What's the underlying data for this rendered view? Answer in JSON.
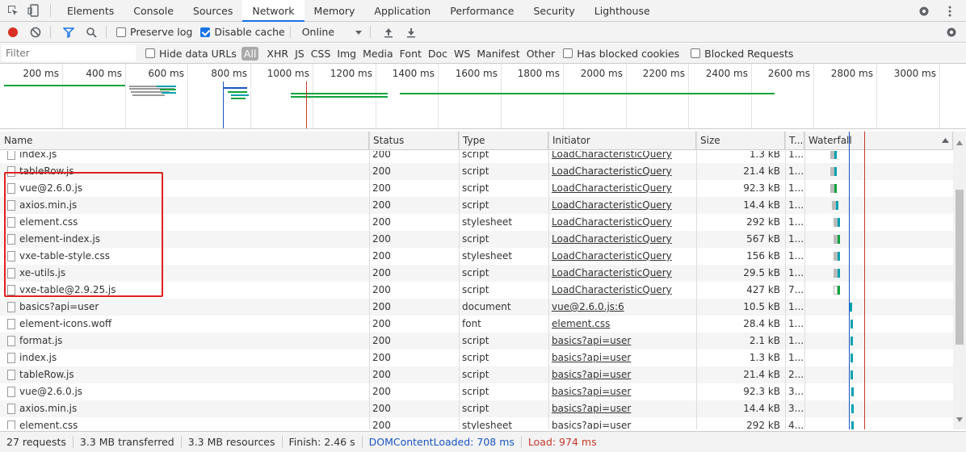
{
  "tabs": [
    "Elements",
    "Console",
    "Sources",
    "Network",
    "Memory",
    "Application",
    "Performance",
    "Security",
    "Lighthouse"
  ],
  "active_tab": "Network",
  "toolbar": {
    "preserve_log": "Preserve log",
    "disable_cache": "Disable cache",
    "throttle": "Online"
  },
  "filterbar": {
    "placeholder": "Filter",
    "hide_data_urls": "Hide data URLs",
    "types": [
      "All",
      "XHR",
      "JS",
      "CSS",
      "Img",
      "Media",
      "Font",
      "Doc",
      "WS",
      "Manifest",
      "Other"
    ],
    "has_blocked_cookies": "Has blocked cookies",
    "blocked_requests": "Blocked Requests"
  },
  "overview_ticks": [
    "200 ms",
    "400 ms",
    "600 ms",
    "800 ms",
    "1000 ms",
    "1200 ms",
    "1400 ms",
    "1600 ms",
    "1800 ms",
    "2000 ms",
    "2200 ms",
    "2400 ms",
    "2600 ms",
    "2800 ms",
    "3000 ms"
  ],
  "columns": {
    "name": "Name",
    "status": "Status",
    "type": "Type",
    "initiator": "Initiator",
    "size": "Size",
    "time": "T...",
    "waterfall": "Waterfall"
  },
  "rows": [
    {
      "name": "index.js",
      "status": "200",
      "type": "script",
      "initiator": "LoadCharacteristicQuery",
      "size": "1.3 kB",
      "time": "1..."
    },
    {
      "name": "tableRow.js",
      "status": "200",
      "type": "script",
      "initiator": "LoadCharacteristicQuery",
      "size": "21.4 kB",
      "time": "1..."
    },
    {
      "name": "vue@2.6.0.js",
      "status": "200",
      "type": "script",
      "initiator": "LoadCharacteristicQuery",
      "size": "92.3 kB",
      "time": "1..."
    },
    {
      "name": "axios.min.js",
      "status": "200",
      "type": "script",
      "initiator": "LoadCharacteristicQuery",
      "size": "14.4 kB",
      "time": "1..."
    },
    {
      "name": "element.css",
      "status": "200",
      "type": "stylesheet",
      "initiator": "LoadCharacteristicQuery",
      "size": "292 kB",
      "time": "1..."
    },
    {
      "name": "element-index.js",
      "status": "200",
      "type": "script",
      "initiator": "LoadCharacteristicQuery",
      "size": "567 kB",
      "time": "1..."
    },
    {
      "name": "vxe-table-style.css",
      "status": "200",
      "type": "stylesheet",
      "initiator": "LoadCharacteristicQuery",
      "size": "156 kB",
      "time": "1..."
    },
    {
      "name": "xe-utils.js",
      "status": "200",
      "type": "script",
      "initiator": "LoadCharacteristicQuery",
      "size": "29.5 kB",
      "time": "1..."
    },
    {
      "name": "vxe-table@2.9.25.js",
      "status": "200",
      "type": "script",
      "initiator": "LoadCharacteristicQuery",
      "size": "427 kB",
      "time": "7..."
    },
    {
      "name": "basics?api=user",
      "status": "200",
      "type": "document",
      "initiator": "vue@2.6.0.js:6",
      "size": "10.5 kB",
      "time": "1..."
    },
    {
      "name": "element-icons.woff",
      "status": "200",
      "type": "font",
      "initiator": "element.css",
      "size": "28.4 kB",
      "time": "1..."
    },
    {
      "name": "format.js",
      "status": "200",
      "type": "script",
      "initiator": "basics?api=user",
      "size": "2.1 kB",
      "time": "1..."
    },
    {
      "name": "index.js",
      "status": "200",
      "type": "script",
      "initiator": "basics?api=user",
      "size": "1.3 kB",
      "time": "1..."
    },
    {
      "name": "tableRow.js",
      "status": "200",
      "type": "script",
      "initiator": "basics?api=user",
      "size": "21.4 kB",
      "time": "2..."
    },
    {
      "name": "vue@2.6.0.js",
      "status": "200",
      "type": "script",
      "initiator": "basics?api=user",
      "size": "92.3 kB",
      "time": "3..."
    },
    {
      "name": "axios.min.js",
      "status": "200",
      "type": "script",
      "initiator": "basics?api=user",
      "size": "14.4 kB",
      "time": "3..."
    },
    {
      "name": "element.css",
      "status": "200",
      "type": "stylesheet",
      "initiator": "basics?api=user",
      "size": "292 kB",
      "time": "4..."
    }
  ],
  "status": {
    "requests": "27 requests",
    "transferred": "3.3 MB transferred",
    "resources": "3.3 MB resources",
    "finish": "Finish: 2.46 s",
    "dcl": "DOMContentLoaded: 708 ms",
    "load": "Load: 974 ms"
  },
  "colors": {
    "accent": "#1a73e8",
    "dcl": "#1a55c0",
    "load": "#c53929",
    "green": "#0ea33e",
    "teal": "#00a0b0"
  }
}
